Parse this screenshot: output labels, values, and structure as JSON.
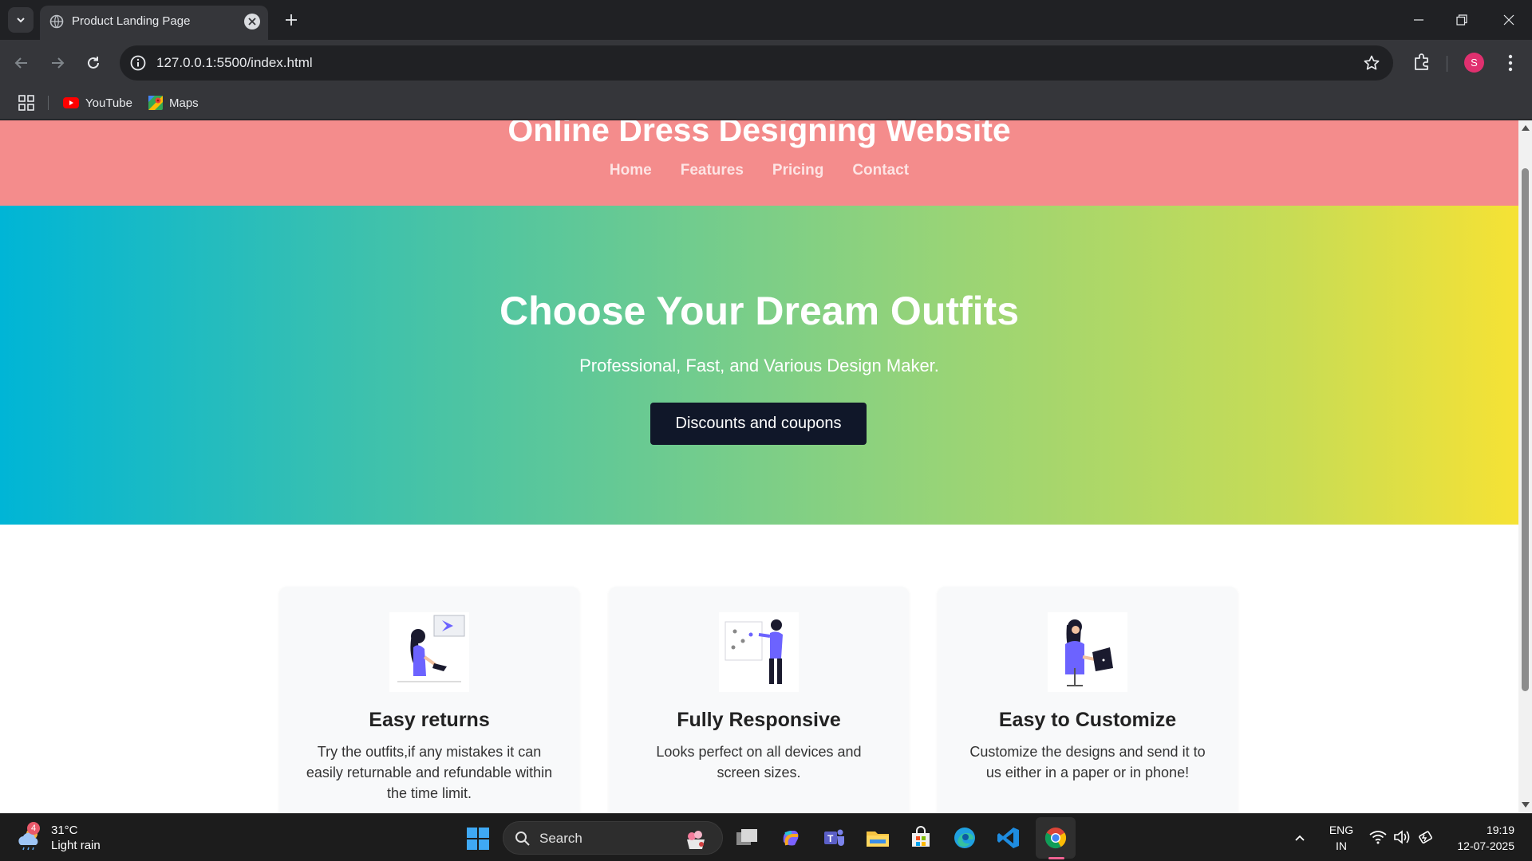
{
  "browser": {
    "tab_title": "Product Landing Page",
    "url": "127.0.0.1:5500/index.html",
    "profile_initial": "S",
    "bookmarks": [
      {
        "label": "YouTube",
        "icon": "youtube-icon"
      },
      {
        "label": "Maps",
        "icon": "maps-icon"
      }
    ]
  },
  "site": {
    "title": "Online Dress Designing Website",
    "nav": [
      "Home",
      "Features",
      "Pricing",
      "Contact"
    ],
    "header_color": "#f48c8c",
    "hero": {
      "title": "Choose Your Dream Outfits",
      "subtitle": "Professional, Fast, and Various Design Maker.",
      "button": "Discounts and coupons",
      "gradient": [
        "#00b5d6",
        "#f6e234"
      ]
    },
    "features": [
      {
        "title": "Easy returns",
        "text": "Try the outfits,if any mistakes it can easily returnable and refundable within the time limit.",
        "illustration": "woman-with-shoe-illustration"
      },
      {
        "title": "Fully Responsive",
        "text": "Looks perfect on all devices and screen sizes.",
        "illustration": "woman-at-board-illustration"
      },
      {
        "title": "Easy to Customize",
        "text": "Customize the designs and send it to us either in a paper or in phone!",
        "illustration": "woman-with-laptop-illustration"
      }
    ]
  },
  "taskbar": {
    "weather_temp": "31°C",
    "weather_desc": "Light rain",
    "weather_badge": "4",
    "search_label": "Search",
    "lang_line1": "ENG",
    "lang_line2": "IN",
    "time": "19:19",
    "date": "12-07-2025"
  }
}
